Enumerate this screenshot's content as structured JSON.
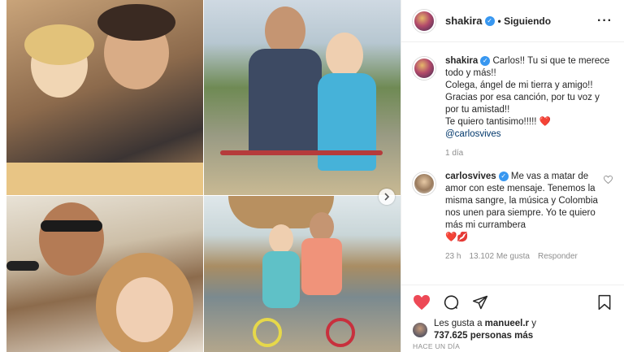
{
  "post": {
    "username": "shakira",
    "follow_status": "Siguiendo",
    "more_icon": "more-dots-icon"
  },
  "caption": {
    "username": "shakira",
    "lines": [
      "Carlos!! Tu si que te merece todo y más!!",
      "Colega, ángel de mi tierra y amigo!!",
      "Gracias por esa canción, por tu voz y por tu amistad!!",
      "Te quiero tantisimo!!!!!"
    ],
    "heart": "❤️",
    "mention": "@carlosvives",
    "time": "1 día"
  },
  "comment": {
    "username": "carlosvives",
    "text": "Me vas a matar de amor con este mensaje. Tenemos la misma sangre, la música y Colombia nos unen para siempre. Yo te quiero más mi currambera",
    "emojis": "❤️💋",
    "time": "23 h",
    "likes": "13.102 Me gusta",
    "reply": "Responder"
  },
  "actions": {
    "like_icon": "heart-filled-icon",
    "comment_icon": "comment-bubble-icon",
    "share_icon": "paper-plane-icon",
    "save_icon": "bookmark-icon"
  },
  "likes": {
    "prefix": "Les gusta a",
    "user": "manueel.r",
    "connector": "y",
    "count": "737.625 personas más"
  },
  "timestamp": "HACE UN DÍA",
  "colors": {
    "heart": "#ed4956",
    "verified": "#3897f0",
    "mention": "#00376b",
    "meta": "#8e8e8e"
  }
}
